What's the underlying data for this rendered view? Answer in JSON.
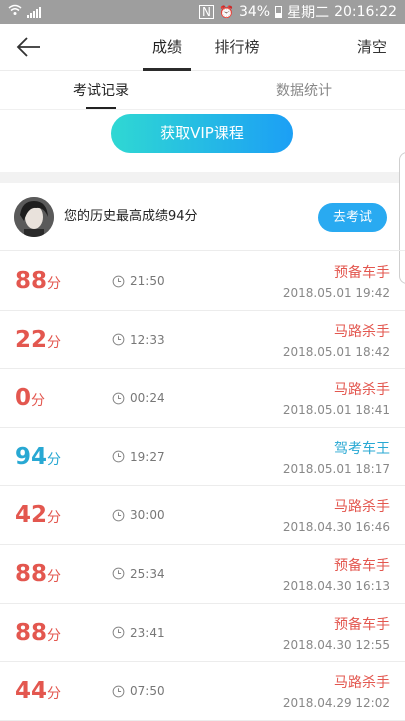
{
  "status_bar": {
    "battery": "34%",
    "weekday": "星期二",
    "time": "20:16:22"
  },
  "nav": {
    "tabs": [
      "成绩",
      "排行榜"
    ],
    "clear_label": "清空"
  },
  "subtabs": [
    "考试记录",
    "数据统计"
  ],
  "vip_button": "获取VIP课程",
  "best": {
    "text": "您的历史最高成绩94分",
    "go_button": "去考试"
  },
  "records": [
    {
      "score": "88",
      "unit": "分",
      "duration": "21:50",
      "title": "预备车手",
      "date": "2018.05.01  19:42",
      "color": "red"
    },
    {
      "score": "22",
      "unit": "分",
      "duration": "12:33",
      "title": "马路杀手",
      "date": "2018.05.01  18:42",
      "color": "red"
    },
    {
      "score": "0",
      "unit": "分",
      "duration": "00:24",
      "title": "马路杀手",
      "date": "2018.05.01  18:41",
      "color": "red"
    },
    {
      "score": "94",
      "unit": "分",
      "duration": "19:27",
      "title": "驾考车王",
      "date": "2018.05.01  18:17",
      "color": "blue"
    },
    {
      "score": "42",
      "unit": "分",
      "duration": "30:00",
      "title": "马路杀手",
      "date": "2018.04.30  16:46",
      "color": "red"
    },
    {
      "score": "88",
      "unit": "分",
      "duration": "25:34",
      "title": "预备车手",
      "date": "2018.04.30  16:13",
      "color": "red"
    },
    {
      "score": "88",
      "unit": "分",
      "duration": "23:41",
      "title": "预备车手",
      "date": "2018.04.30  12:55",
      "color": "red"
    },
    {
      "score": "44",
      "unit": "分",
      "duration": "07:50",
      "title": "马路杀手",
      "date": "2018.04.29  12:02",
      "color": "red"
    }
  ],
  "colors": {
    "red": "#e3574f",
    "blue": "#28a8d3",
    "accent": "#29aaf1"
  }
}
